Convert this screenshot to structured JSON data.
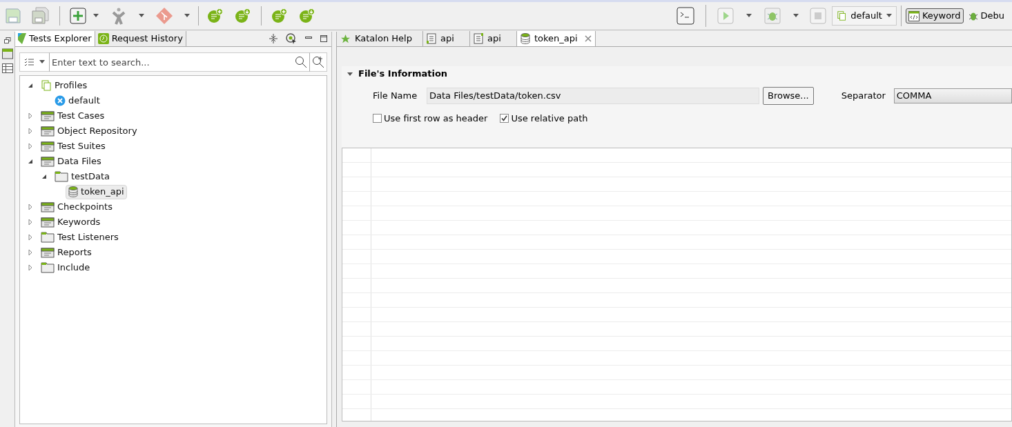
{
  "toolbar": {
    "profile": "default",
    "perspectives": [
      {
        "label": "Keyword",
        "selected": true
      },
      {
        "label": "Debu",
        "selected": false
      }
    ]
  },
  "explorer": {
    "tabs": [
      {
        "label": "Tests Explorer",
        "selected": true,
        "kind": "explorer"
      },
      {
        "label": "Request History",
        "selected": false,
        "kind": "history"
      }
    ],
    "search": {
      "placeholder": "Enter text to search..."
    },
    "tree": [
      {
        "label": "Profiles",
        "kind": "profiles",
        "expanded": true,
        "selected": false,
        "children": [
          {
            "label": "default",
            "kind": "profile",
            "selected": false
          }
        ]
      },
      {
        "label": "Test Cases",
        "kind": "test-cases",
        "expanded": false,
        "selected": false
      },
      {
        "label": "Object Repository",
        "kind": "object-repository",
        "expanded": false,
        "selected": false
      },
      {
        "label": "Test Suites",
        "kind": "test-suites",
        "expanded": false,
        "selected": false
      },
      {
        "label": "Data Files",
        "kind": "data-files",
        "expanded": true,
        "selected": false,
        "children": [
          {
            "label": "testData",
            "kind": "folder",
            "expanded": true,
            "selected": false,
            "children": [
              {
                "label": "token_api",
                "kind": "data-file",
                "selected": true
              }
            ]
          }
        ]
      },
      {
        "label": "Checkpoints",
        "kind": "checkpoints",
        "expanded": false,
        "selected": false
      },
      {
        "label": "Keywords",
        "kind": "keywords",
        "expanded": false,
        "selected": false
      },
      {
        "label": "Test Listeners",
        "kind": "folder",
        "expanded": false,
        "selected": false
      },
      {
        "label": "Reports",
        "kind": "reports",
        "expanded": false,
        "selected": false
      },
      {
        "label": "Include",
        "kind": "folder",
        "expanded": false,
        "selected": false
      }
    ]
  },
  "editor": {
    "tabs": [
      {
        "label": "Katalon Help",
        "kind": "help",
        "selected": false,
        "closable": false
      },
      {
        "label": "api",
        "kind": "test-case",
        "selected": false,
        "closable": false
      },
      {
        "label": "api",
        "kind": "test-suite",
        "selected": false,
        "closable": false
      },
      {
        "label": "token_api",
        "kind": "data-file",
        "selected": true,
        "closable": true
      }
    ],
    "section": {
      "title": "File's Information",
      "expanded": true
    },
    "file_name_label": "File Name",
    "file_name": "Data Files/testData/token.csv",
    "browse": "Browse...",
    "separator_label": "Separator",
    "separator": "COMMA",
    "options": [
      {
        "label": "Use first row as header",
        "checked": false
      },
      {
        "label": "Use relative path",
        "checked": true
      }
    ]
  }
}
